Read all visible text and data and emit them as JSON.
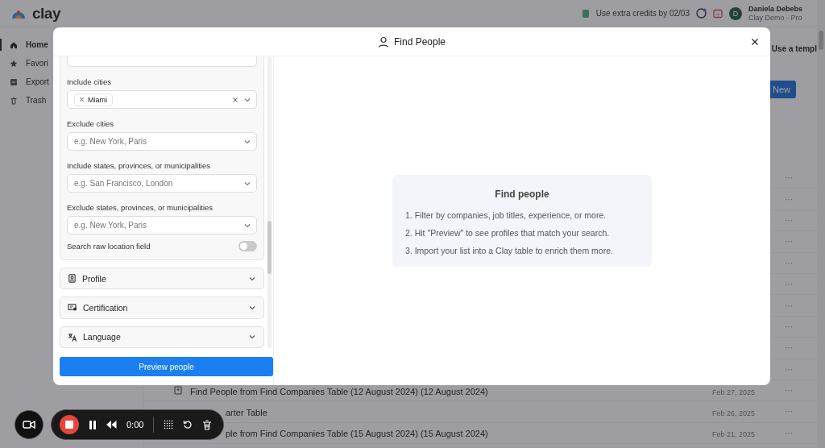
{
  "app": {
    "logo": "clay",
    "credits": "Use extra credits by 02/03",
    "user": {
      "initial": "D",
      "name": "Daniela Debebs",
      "plan": "Clay Demo - Pro"
    }
  },
  "sidebar": {
    "items": [
      {
        "label": "Home",
        "selected": true
      },
      {
        "label": "Favori",
        "selected": false
      },
      {
        "label": "Export",
        "selected": false
      },
      {
        "label": "Trash",
        "selected": false
      }
    ]
  },
  "main": {
    "template_button": "Use a templ",
    "new_button": "New",
    "rows": [
      {
        "more": "···"
      },
      {
        "more": "···"
      },
      {
        "more": "···"
      },
      {
        "more": "···"
      },
      {
        "more": "···"
      },
      {
        "more": "···"
      },
      {
        "more": "···"
      },
      {
        "more": "···"
      },
      {
        "more": "···"
      },
      {
        "more": "···"
      },
      {
        "title": "Find People from Find Companies Table (12 August 2024) (12 August 2024)",
        "date": "Feb 27, 2025",
        "more": "···",
        "icon": true
      },
      {
        "title": "arter Table",
        "date": "Feb 26, 2025",
        "more": "···",
        "icon": false
      },
      {
        "title": "ple from Find Companies Table (15 August 2024) (15 August 2024)",
        "date": "Feb 21, 2025",
        "more": "···",
        "icon": false
      }
    ]
  },
  "modal": {
    "title": "Find People",
    "filters": [
      {
        "label": "Include cities",
        "values": [
          "Miami"
        ]
      },
      {
        "label": "Exclude cities",
        "placeholder": "e.g. New York, Paris"
      },
      {
        "label": "Include states, provinces, or municipalities",
        "placeholder": "e.g. San Francisco, London"
      },
      {
        "label": "Exclude states, provinces, or municipalities",
        "placeholder": "e.g. New York, Paris"
      }
    ],
    "toggle": {
      "label": "Search raw location field",
      "on": false
    },
    "sections": [
      {
        "label": "Profile",
        "expanded": false
      },
      {
        "label": "Certification",
        "expanded": false
      },
      {
        "label": "Language",
        "expanded": false
      }
    ],
    "preview_button": "Preview people",
    "info": {
      "title": "Find people",
      "steps": [
        "1. Filter by companies, job titles, experience, or more.",
        "2. Hit \"Preview\" to see profiles that match your search.",
        "3. Import your list into a Clay table to enrich them more."
      ]
    }
  },
  "recorder": {
    "time": "0:00"
  }
}
